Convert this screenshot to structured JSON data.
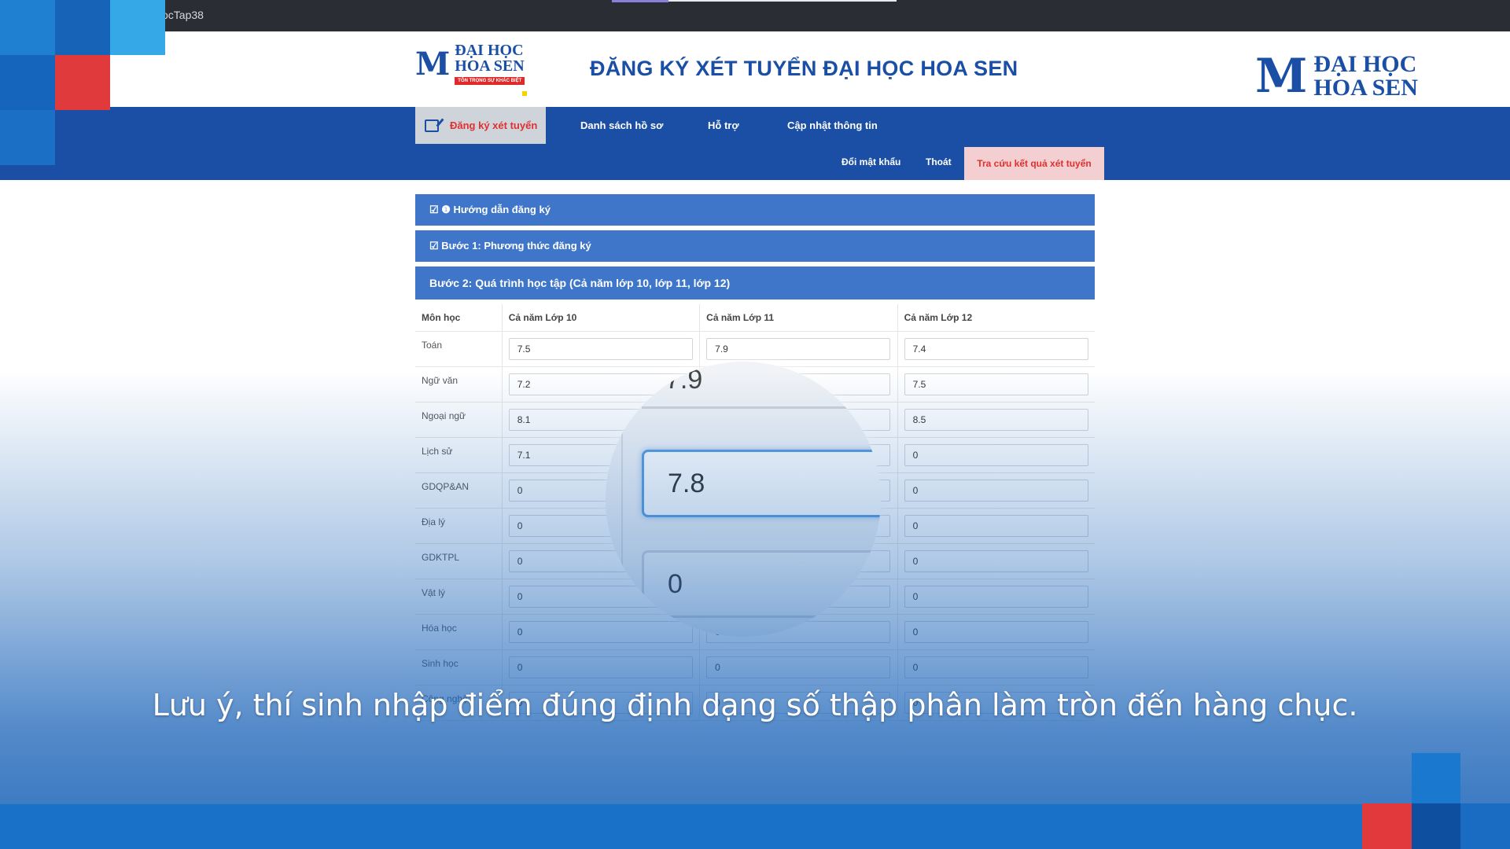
{
  "browser": {
    "tab_title": "ocTap38"
  },
  "header": {
    "title": "ĐĂNG KÝ XÉT TUYỂN ĐẠI HỌC HOA SEN",
    "logo_line1": "ĐẠI HỌC",
    "logo_line2": "HOA SEN",
    "logo_tagline": "TÔN TRỌNG SỰ KHÁC BIỆT",
    "logo_mark": "M"
  },
  "nav": {
    "register": "Đăng ký xét tuyển",
    "applications": "Danh sách hồ sơ",
    "support": "Hỗ trợ",
    "update_info": "Cập nhật thông tin",
    "change_password": "Đổi mật khẩu",
    "logout": "Thoát",
    "lookup_results": "Tra cứu kết quả xét tuyển"
  },
  "accordion": {
    "guide": "☑ ❶ Hướng dẫn đăng ký",
    "step1": "☑ Bước 1: Phương thức đăng ký",
    "step2": "Bước 2: Quá trình học tập (Cả năm lớp 10, lớp 11, lớp 12)"
  },
  "grades": {
    "headers": [
      "Môn học",
      "Cả năm Lớp 10",
      "Cả năm Lớp 11",
      "Cả năm Lớp 12"
    ],
    "rows": [
      {
        "subject": "Toán",
        "g10": "7.5",
        "g11": "7.9",
        "g12": "7.4"
      },
      {
        "subject": "Ngữ văn",
        "g10": "7.2",
        "g11": "",
        "g12": "7.5"
      },
      {
        "subject": "Ngoại ngữ",
        "g10": "8.1",
        "g11": "",
        "g12": "8.5"
      },
      {
        "subject": "Lịch sử",
        "g10": "7.1",
        "g11": "7.8",
        "g12": "0"
      },
      {
        "subject": "GDQP&AN",
        "g10": "0",
        "g11": "0",
        "g12": "0"
      },
      {
        "subject": "Địa lý",
        "g10": "0",
        "g11": "0",
        "g12": "0"
      },
      {
        "subject": "GDKTPL",
        "g10": "0",
        "g11": "0",
        "g12": "0"
      },
      {
        "subject": "Vật lý",
        "g10": "0",
        "g11": "0",
        "g12": "0"
      },
      {
        "subject": "Hóa học",
        "g10": "0",
        "g11": "0",
        "g12": "0"
      },
      {
        "subject": "Sinh học",
        "g10": "0",
        "g11": "0",
        "g12": "0"
      },
      {
        "subject": "Công nghệ",
        "g10": "0",
        "g11": "0",
        "g12": "0"
      }
    ]
  },
  "magnifier": {
    "above": "7.9",
    "focused": "7.8",
    "below": "0"
  },
  "caption": "Lưu ý, thí sinh nhập điểm đúng định dạng số thập phân làm tròn đến hàng chục.",
  "colors": {
    "brand_blue": "#1a4fa5",
    "accent_red": "#e0302f",
    "panel_blue": "#3f76c9"
  }
}
